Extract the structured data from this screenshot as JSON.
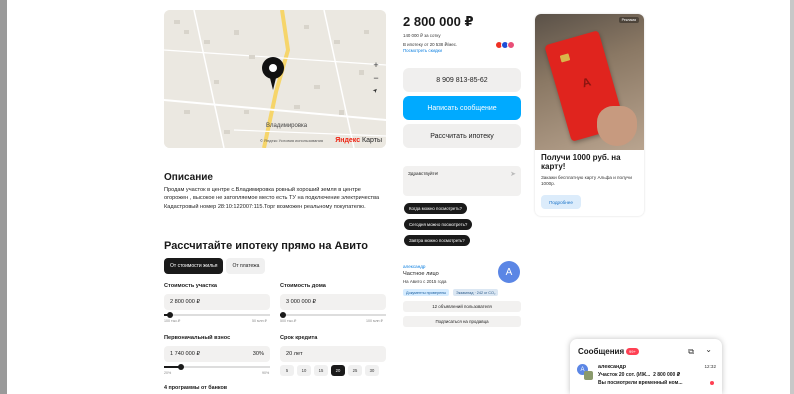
{
  "map": {
    "street_label": "Владимировка",
    "footer": "© Яндекс Условия использования",
    "brand_y": "Яндекс",
    "brand_rest": " Карты",
    "zoom_in": "+",
    "zoom_out": "−",
    "locate": "➤"
  },
  "description": {
    "title": "Описание",
    "text": "Продам участок в центре с.Владимировка ровный хороший земля в центре огорожен , высокое не затопляемое место есть ТУ на подключение электричества Кадастровый номер 28:10:122007:115.Торг возможен реальному покупателю."
  },
  "mortgage": {
    "title": "Рассчитайте ипотеку прямо на Авито",
    "tabs": [
      "От стоимости жилья",
      "От платежа"
    ],
    "plot_label": "Стоимость участка",
    "plot_value": "2 800 000 ₽",
    "plot_min": "100 тыс.₽",
    "plot_max": "50 млн ₽",
    "plot_fraction": 0.06,
    "house_label": "Стоимость дома",
    "house_value": "3 000 000 ₽",
    "house_min": "500 тыс.₽",
    "house_max": "100 млн ₽",
    "house_fraction": 0.03,
    "down_label": "Первоначальный взнос",
    "down_value": "1 740 000 ₽",
    "down_percent": "30%",
    "down_min": "20%",
    "down_max": "90%",
    "down_fraction": 0.16,
    "term_label": "Срок кредита",
    "term_value": "20 лет",
    "term_chips": [
      "5",
      "10",
      "15",
      "20",
      "25",
      "30"
    ],
    "term_active": "20",
    "programs": "4 программы от банков"
  },
  "listing": {
    "price": "2 800 000 ₽",
    "per_sotka": "140 000 ₽ за сотку",
    "mortgage_from": "В ипотеку от 20 538 ₽/мес.",
    "mortgage_link": "Посмотреть скидки",
    "phone_button": "8 909 813-85-62",
    "message_button": "Написать сообщение",
    "calc_button": "Рассчитать ипотеку",
    "bank_colors": [
      "#ef3124",
      "#1d4ed8",
      "#e94e77"
    ]
  },
  "chat": {
    "greeting": "Здравствуйте!",
    "send_icon": "➤",
    "quick_questions": [
      "Когда можно посмотреть?",
      "Сегодня можно посмотреть?",
      "Завтра можно посмотреть?"
    ]
  },
  "seller": {
    "name": "александр",
    "type": "Частное лицо",
    "since": "На Авито с 2015 года",
    "badge_docs": "Документы проверены",
    "badge_eco": "Экзамлад · 242 кг CO₂",
    "avatar_letter": "A",
    "listings_button": "12 объявлений пользователя",
    "subscribe_button": "Подписаться на продавца"
  },
  "ad": {
    "tag": "Реклама",
    "logo": "А",
    "title": "Получи 1000 руб. на карту!",
    "text": "Закажи бесплатную карту Альфа и получи 1000р.",
    "button": "Подробнее"
  },
  "messages": {
    "title": "Сообщения",
    "count": "99+",
    "open_icon": "⧉",
    "collapse_icon": "⌄",
    "author": "александр",
    "avatar_letter": "A",
    "time": "12:32",
    "subject": "Участок 20 сот. (ИЖ...",
    "price": "2 800 000 ₽",
    "preview": "Вы посмотрели временный ном..."
  }
}
